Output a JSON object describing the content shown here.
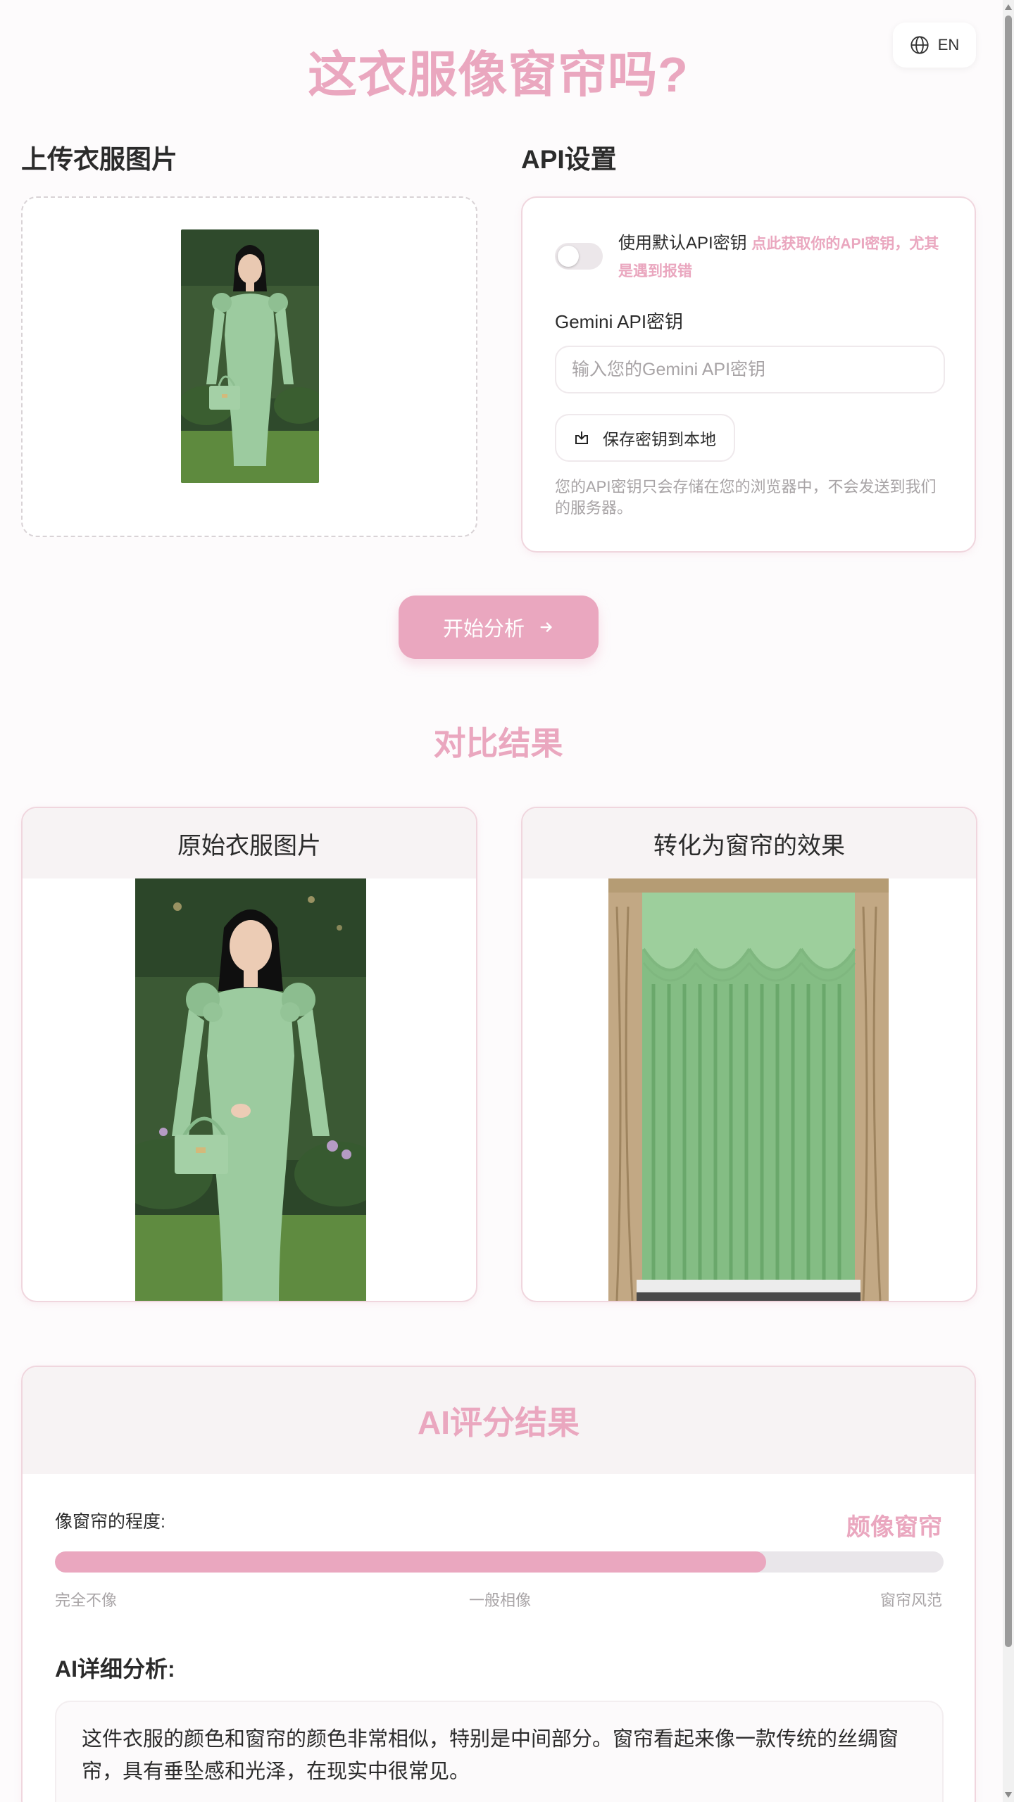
{
  "language_toggle": {
    "label": "EN"
  },
  "title": "这衣服像窗帘吗?",
  "upload": {
    "heading": "上传衣服图片"
  },
  "api_settings": {
    "heading": "API设置",
    "toggle_label": "使用默认API密钥",
    "toggle_link": "点此获取你的API密钥，尤其是遇到报错",
    "toggle_on": false,
    "key_label": "Gemini API密钥",
    "key_value": "",
    "key_placeholder": "输入您的Gemini API密钥",
    "save_label": "保存密钥到本地",
    "note": "您的API密钥只会存储在您的浏览器中，不会发送到我们的服务器。"
  },
  "start_button": {
    "label": "开始分析",
    "icon": "arrow-right-icon"
  },
  "comparison": {
    "title": "对比结果",
    "original_title": "原始衣服图片",
    "converted_title": "转化为窗帘的效果"
  },
  "score": {
    "title": "AI评分结果",
    "degree_label": "像窗帘的程度:",
    "verdict": "颇像窗帘",
    "value_fraction": 0.8,
    "scale_low": "完全不像",
    "scale_mid": "一般相像",
    "scale_high": "窗帘风范",
    "detail_heading": "AI详细分析:",
    "detail_text": "这件衣服的颜色和窗帘的颜色非常相似，特别是中间部分。窗帘看起来像一款传统的丝绸窗帘，具有垂坠感和光泽，在现实中很常见。"
  },
  "colors": {
    "accent": "#eaa7bf",
    "dress": "#9ccb9f",
    "background": "#fdfbfc"
  }
}
